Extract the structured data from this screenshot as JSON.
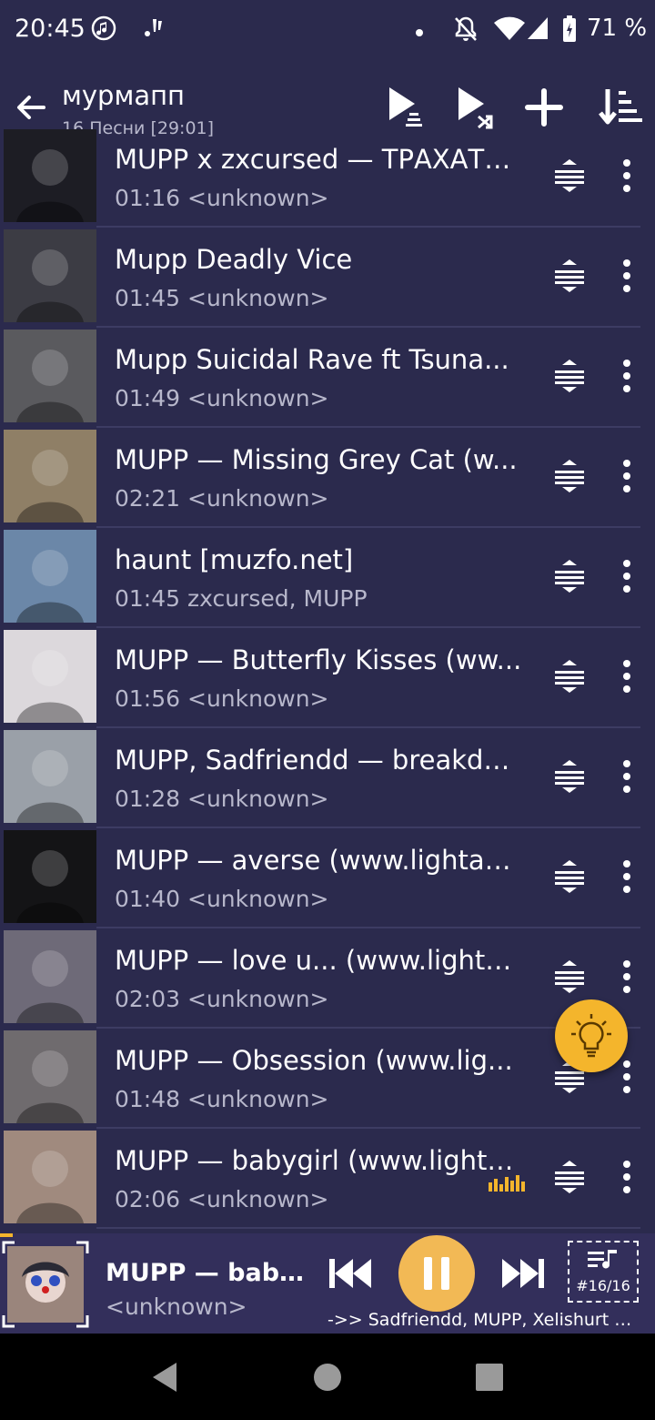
{
  "status_bar": {
    "time": "20:45",
    "battery": "71 %"
  },
  "app_bar": {
    "title": "мурмапп",
    "subtitle": "16 Песни [29:01]"
  },
  "tracks": [
    {
      "title": "MUPP x zxcursed — ТРАХАТЬ...",
      "meta": "01:16 <unknown>",
      "thumb": "#1d1d24"
    },
    {
      "title": "Mupp Deadly Vice",
      "meta": "01:45 <unknown>",
      "thumb": "#3c3c44"
    },
    {
      "title": "Mupp Suicidal Rave ft Tsuna...",
      "meta": "01:49 <unknown>",
      "thumb": "#5a5a5e"
    },
    {
      "title": "MUPP — Missing Grey Cat (w...",
      "meta": "02:21 <unknown>",
      "thumb": "#8f7f66"
    },
    {
      "title": "haunt [muzfo.net]",
      "meta": "01:45 zxcursed, MUPP",
      "thumb": "#6b87a8"
    },
    {
      "title": "MUPP — Butterfly Kisses (ww...",
      "meta": "01:56 <unknown>",
      "thumb": "#dcd8dc"
    },
    {
      "title": "MUPP, Sadfriendd — breakdo...",
      "meta": "01:28 <unknown>",
      "thumb": "#9aa0a8"
    },
    {
      "title": "MUPP — averse (www.lightau...",
      "meta": "01:40 <unknown>",
      "thumb": "#141416"
    },
    {
      "title": "MUPP — love u... (www.lighta...",
      "meta": "02:03 <unknown>",
      "thumb": "#6e6a78"
    },
    {
      "title": "MUPP — Obsession (www.lig...",
      "meta": "01:48 <unknown>",
      "thumb": "#6f6b6e"
    },
    {
      "title": "MUPP — babygirl (www.lighta...",
      "meta": "02:06 <unknown>",
      "thumb": "#a08a7e"
    }
  ],
  "player": {
    "title": "MUPP — babygi...",
    "artist": "<unknown>",
    "queue_position": "#16/16",
    "next_up": "->> Sadfriendd, MUPP, Xelishurt — ...",
    "progress_fraction": 0.02
  },
  "colors": {
    "background": "#2b2a4d",
    "accent": "#f4b52c",
    "player_bg": "#332f5b"
  },
  "icons": [
    "back-arrow-icon",
    "play-queue-icon",
    "shuffle-play-icon",
    "add-icon",
    "sort-icon",
    "drag-handle-icon",
    "more-vert-icon",
    "lightbulb-icon",
    "equalizer-icon",
    "skip-previous-icon",
    "pause-icon",
    "skip-next-icon",
    "queue-music-icon"
  ]
}
